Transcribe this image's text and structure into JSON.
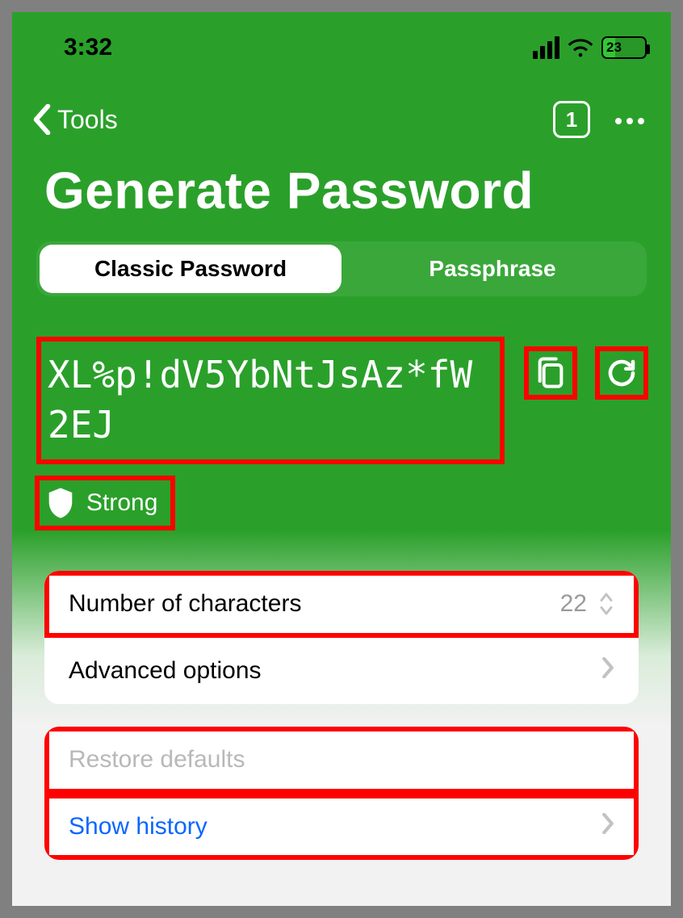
{
  "status": {
    "time": "3:32",
    "battery_percent": "23"
  },
  "nav": {
    "back_label": "Tools",
    "tab_count": "1"
  },
  "title": "Generate Password",
  "segmented": {
    "classic": "Classic Password",
    "passphrase": "Passphrase"
  },
  "password": {
    "value": "XL%p!dV5YbNtJsAz*fW2EJ",
    "strength": "Strong"
  },
  "options": {
    "num_chars_label": "Number of characters",
    "num_chars_value": "22",
    "advanced_label": "Advanced options"
  },
  "actions": {
    "restore": "Restore defaults",
    "history": "Show history"
  }
}
